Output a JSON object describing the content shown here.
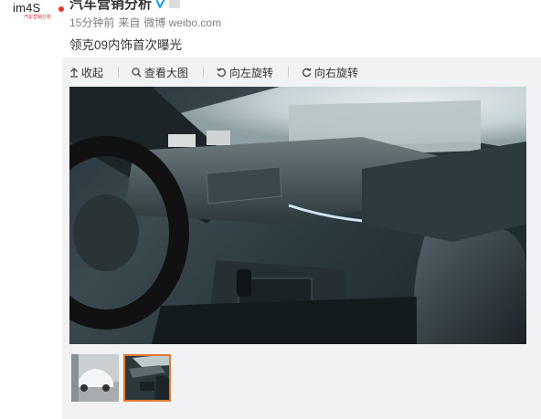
{
  "avatar": {
    "logo_text": "im4S",
    "logo_sub": "汽车营销分析"
  },
  "author": {
    "name": "汽车营销分析"
  },
  "meta": {
    "time": "15分钟前",
    "source_prefix": "来自",
    "source": "微博 weibo.com"
  },
  "post": {
    "text": "领克09内饰首次曝光"
  },
  "toolbar": {
    "collapse_label": "收起",
    "view_large_label": "查看大图",
    "rotate_left_label": "向左旋转",
    "rotate_right_label": "向右旋转"
  },
  "thumbnails": {
    "count": 2,
    "active_index": 1
  },
  "colors": {
    "accent_orange": "#e07a2f",
    "verified_blue": "#1f9cf0",
    "meta_gray": "#808080"
  },
  "icons": [
    "verified-icon",
    "member-icon",
    "collapse-icon",
    "search-icon",
    "rotate-left-icon",
    "rotate-right-icon"
  ]
}
